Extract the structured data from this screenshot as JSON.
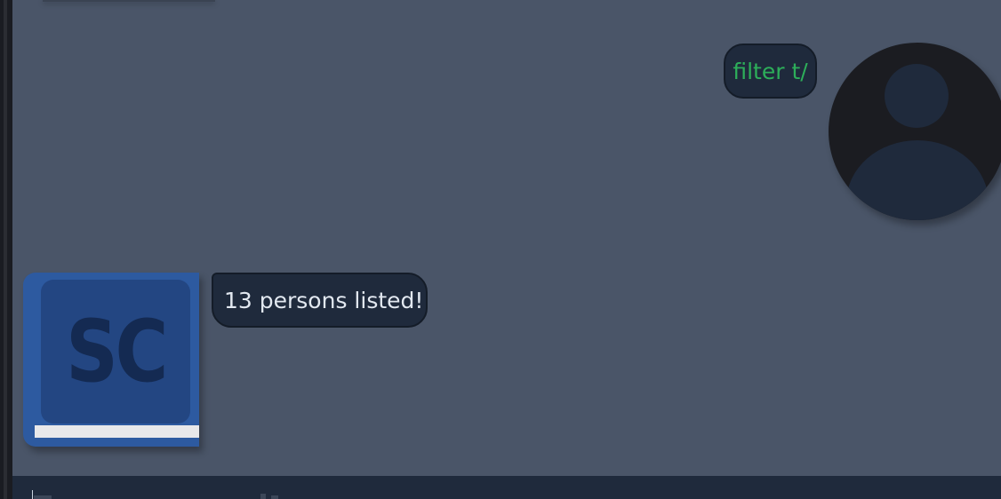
{
  "messages": [
    {
      "sender": "user",
      "text": "filter t/"
    },
    {
      "sender": "bot",
      "text": "13 persons listed!"
    }
  ],
  "user_avatar": {
    "icon": "person-silhouette-icon"
  },
  "bot_avatar": {
    "icon": "book-logo-icon",
    "logo_text": "SC"
  },
  "command_input": {
    "value": "",
    "placeholder": ""
  },
  "colors": {
    "background": "#4a5568",
    "bubble": "#1f2a3c",
    "user_text": "#2dae5a",
    "bot_text": "#e2e8f0",
    "logo_blue": "#2d5aa0"
  }
}
